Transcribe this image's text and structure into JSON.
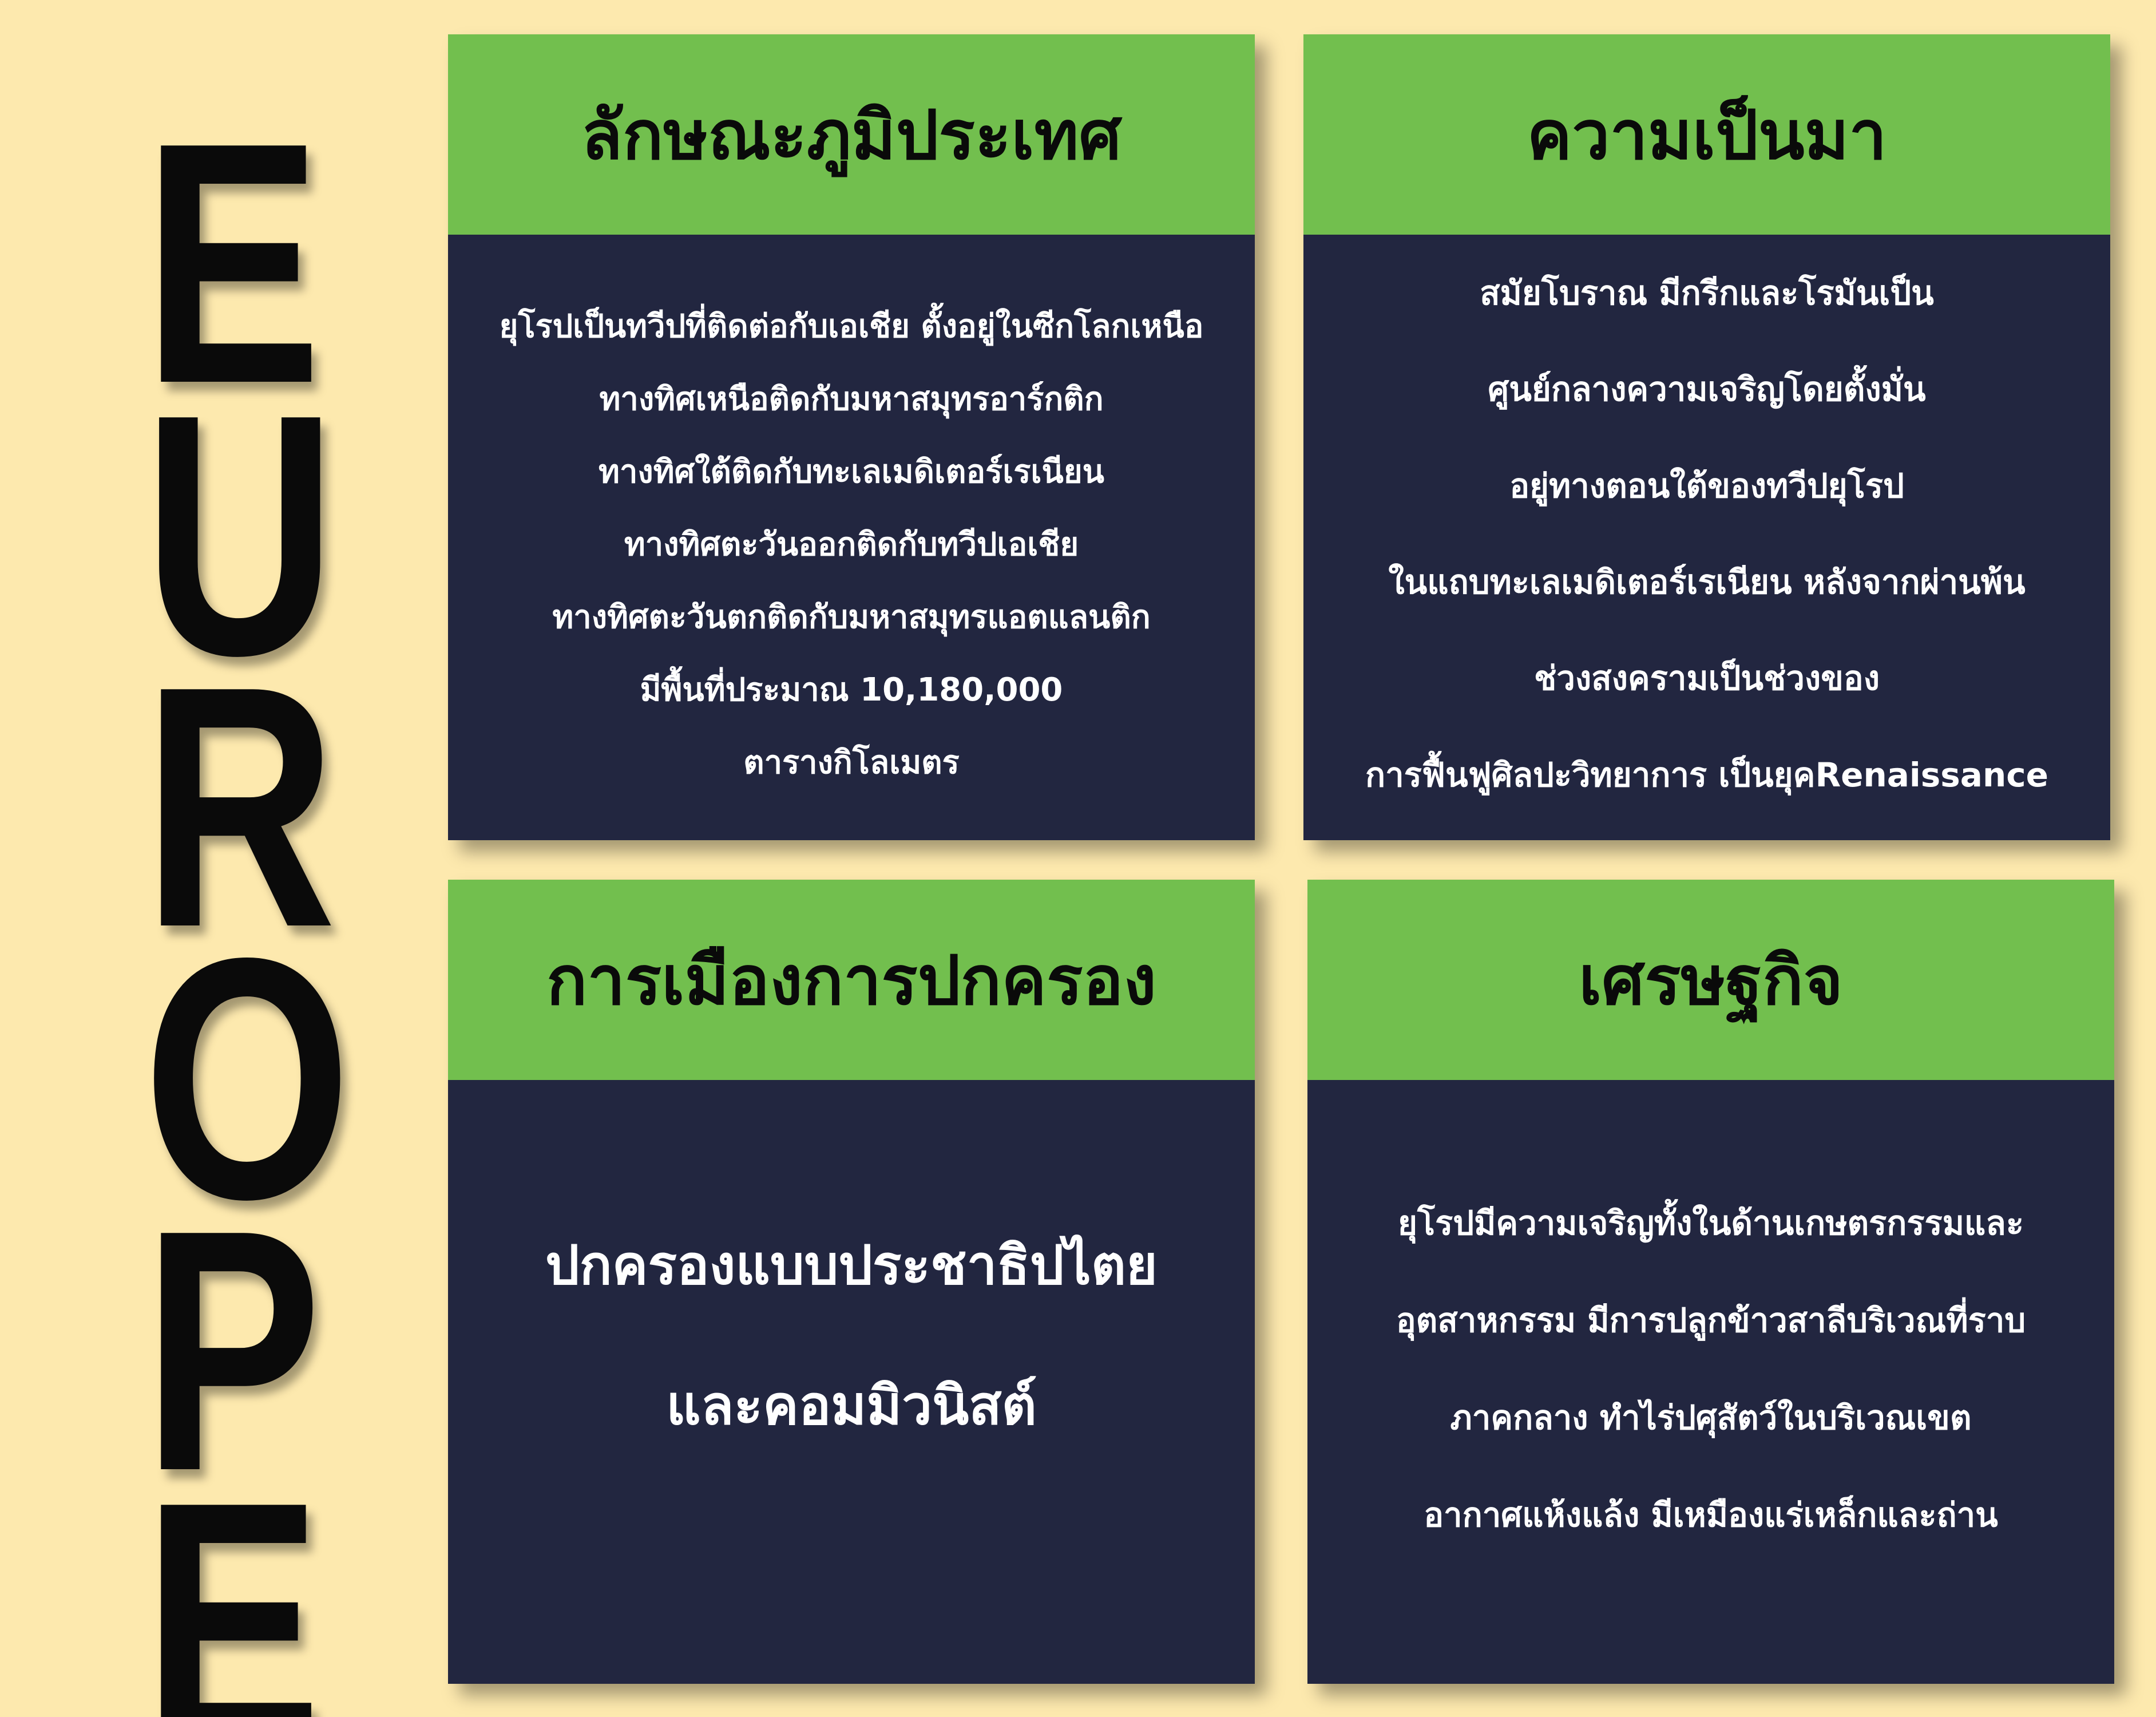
{
  "side_title": [
    "E",
    "U",
    "R",
    "O",
    "P",
    "E"
  ],
  "cards": {
    "geography": {
      "title": "ลักษณะภูมิประเทศ",
      "lines": [
        "ยุโรปเป็นทวีปที่ติดต่อกับเอเชีย ตั้งอยู่ในซีกโลกเหนือ",
        "ทางทิศเหนือติดกับมหาสมุทรอาร์กติก",
        "ทางทิศใต้ติดกับทะเลเมดิเตอร์เรเนียน",
        "ทางทิศตะวันออกติดกับทวีปเอเชีย",
        "ทางทิศตะวันตกติดกับมหาสมุทรแอตแลนติก",
        "มีพื้นที่ประมาณ 10,180,000",
        "ตารางกิโลเมตร"
      ]
    },
    "history": {
      "title": "ความเป็นมา",
      "lines": [
        "สมัยโบราณ มีกรีกและโรมันเป็น",
        "ศูนย์กลางความเจริญโดยตั้งมั่น",
        "อยู่ทางตอนใต้ของทวีปยุโรป",
        "ในแถบทะเลเมดิเตอร์เรเนียน หลังจากผ่านพ้น",
        "ช่วงสงครามเป็นช่วงของ",
        "การฟื้นฟูศิลปะวิทยาการ เป็นยุคRenaissance"
      ]
    },
    "government": {
      "title": "การเมืองการปกครอง",
      "lines": [
        "ปกครองแบบประชาธิปไตย",
        "และคอมมิวนิสต์"
      ]
    },
    "economy": {
      "title": "เศรษฐกิจ",
      "lines": [
        "ยุโรปมีความเจริญทั้งในด้านเกษตรกรรมและ",
        "อุตสาหกรรม มีการปลูกข้าวสาลีบริเวณที่ราบ",
        "ภาคกลาง ทำไร่ปศุสัตว์ในบริเวณเขต",
        "อากาศแห้งแล้ง มีเหมืองแร่เหล็กและถ่าน"
      ]
    }
  },
  "colors": {
    "background": "#fde9ae",
    "header_green": "#72bf4e",
    "body_navy": "#222640",
    "title_text": "#0a0a0a",
    "body_text": "#ffffff"
  }
}
